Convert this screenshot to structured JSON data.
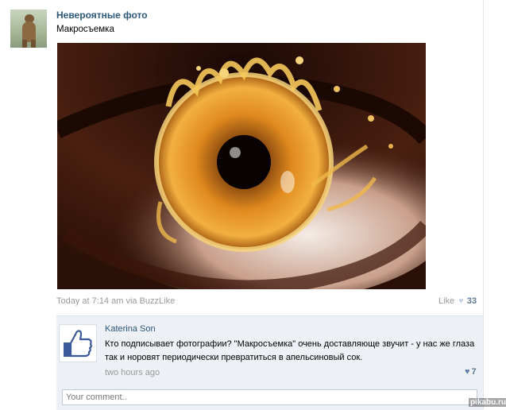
{
  "post": {
    "author": "Невероятные фото",
    "text": "Макросъемка",
    "meta": "Today at 7:14 am via BuzzLike",
    "like_label": "Like",
    "like_count": "33"
  },
  "comment": {
    "author": "Katerina Son",
    "text": "Кто подписывает фотографии? \"Макросъемка\" очень доставляюще звучит - у нас же глаза так и норовят периодически превратиться в апельсиновый сок.",
    "time": "two hours ago",
    "like_count": "7"
  },
  "comment_input": {
    "placeholder": "Your comment.."
  },
  "watermark": "pikabu.ru",
  "icons": {
    "post_avatar": "bear-avatar-icon",
    "comment_avatar": "thumbs-up-icon",
    "like": "heart-icon"
  },
  "colors": {
    "link": "#2b587a",
    "muted": "#999999",
    "comment_bg": "#edf1f5",
    "like_count": "#5f7a96"
  }
}
